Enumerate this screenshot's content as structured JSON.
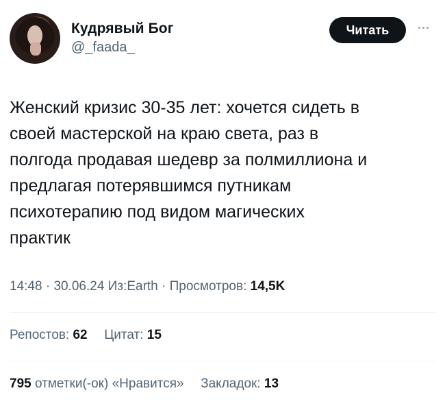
{
  "author": {
    "name": "Кудрявый Бог",
    "handle": "@_faada_"
  },
  "follow_button_label": "Читать",
  "tweet": {
    "lines": [
      "Женский кризис 30-35 лет: хочется сидеть в",
      "своей мастерской на краю света, раз в",
      "полгода продавая шедевр за полмиллиона и",
      "предлагая потерявшимся путникам",
      "психотерапию под видом магических",
      "практик"
    ]
  },
  "meta": {
    "time": "14:48",
    "separator": "·",
    "date": "30.06.24",
    "source": "Из:Earth",
    "views_label": "Просмотров:",
    "views_value": "14,5K"
  },
  "stats": {
    "reposts_label": "Репостов:",
    "reposts_value": "62",
    "quotes_label": "Цитат:",
    "quotes_value": "15",
    "likes_value": "795",
    "likes_label": "отметки(-ок) «Нравится»",
    "bookmarks_label": "Закладок:",
    "bookmarks_value": "13"
  },
  "icons": {
    "more": "more-dots-icon"
  }
}
